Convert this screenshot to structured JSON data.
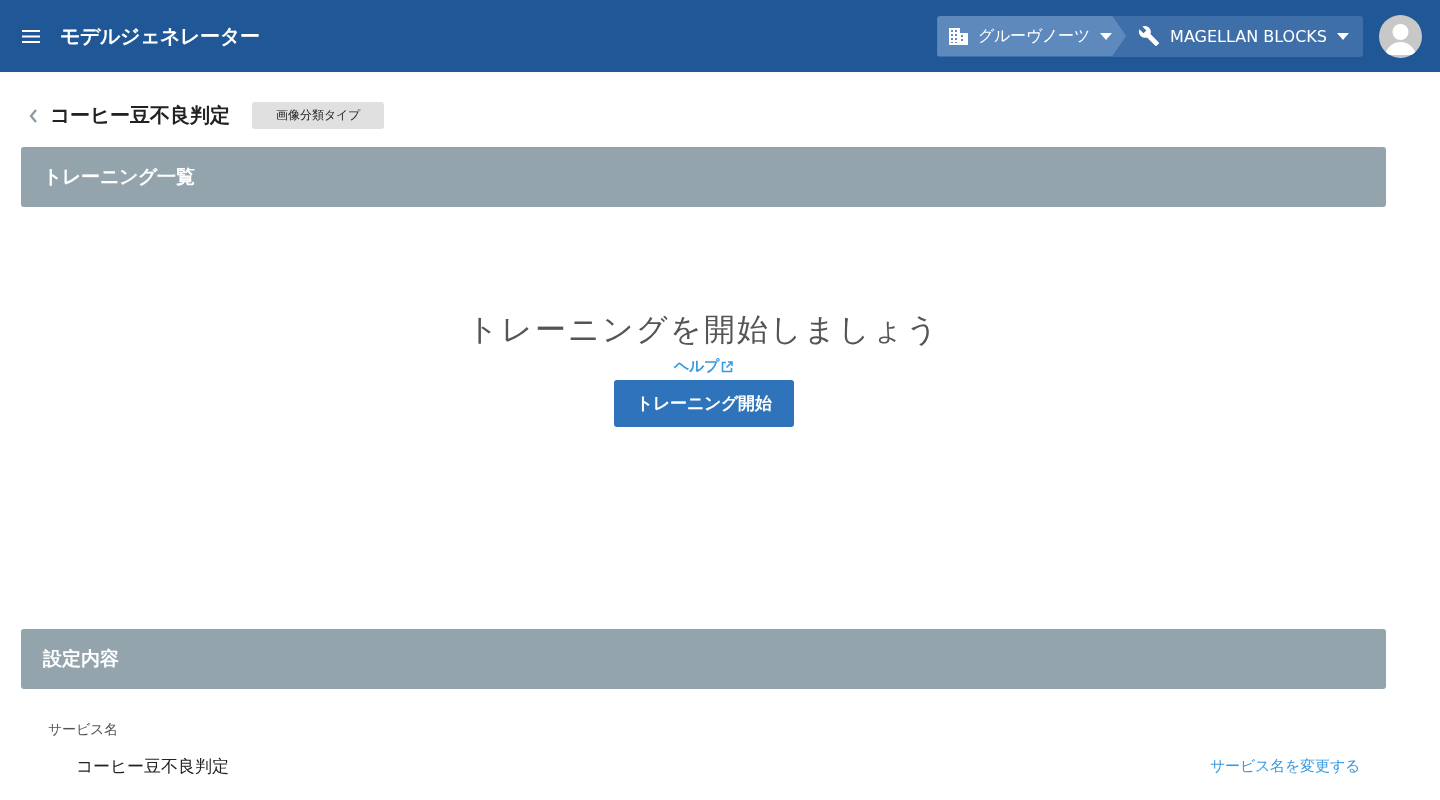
{
  "app_bar": {
    "title": "モデルジェネレーター",
    "breadcrumbs": [
      {
        "kind": "group",
        "label": "グルーヴノーツ"
      },
      {
        "kind": "tool",
        "label": "MAGELLAN BLOCKS"
      }
    ]
  },
  "page": {
    "title": "コーヒー豆不良判定",
    "type_badge": "画像分類タイプ"
  },
  "training_section": {
    "header": "トレーニング一覧",
    "empty_message": "トレーニングを開始しましょう",
    "help_link": "ヘルプ",
    "start_button": "トレーニング開始"
  },
  "settings_section": {
    "header": "設定内容",
    "fields": [
      {
        "label": "サービス名",
        "value": "コーヒー豆不良判定",
        "action": "サービス名を変更する"
      }
    ]
  }
}
